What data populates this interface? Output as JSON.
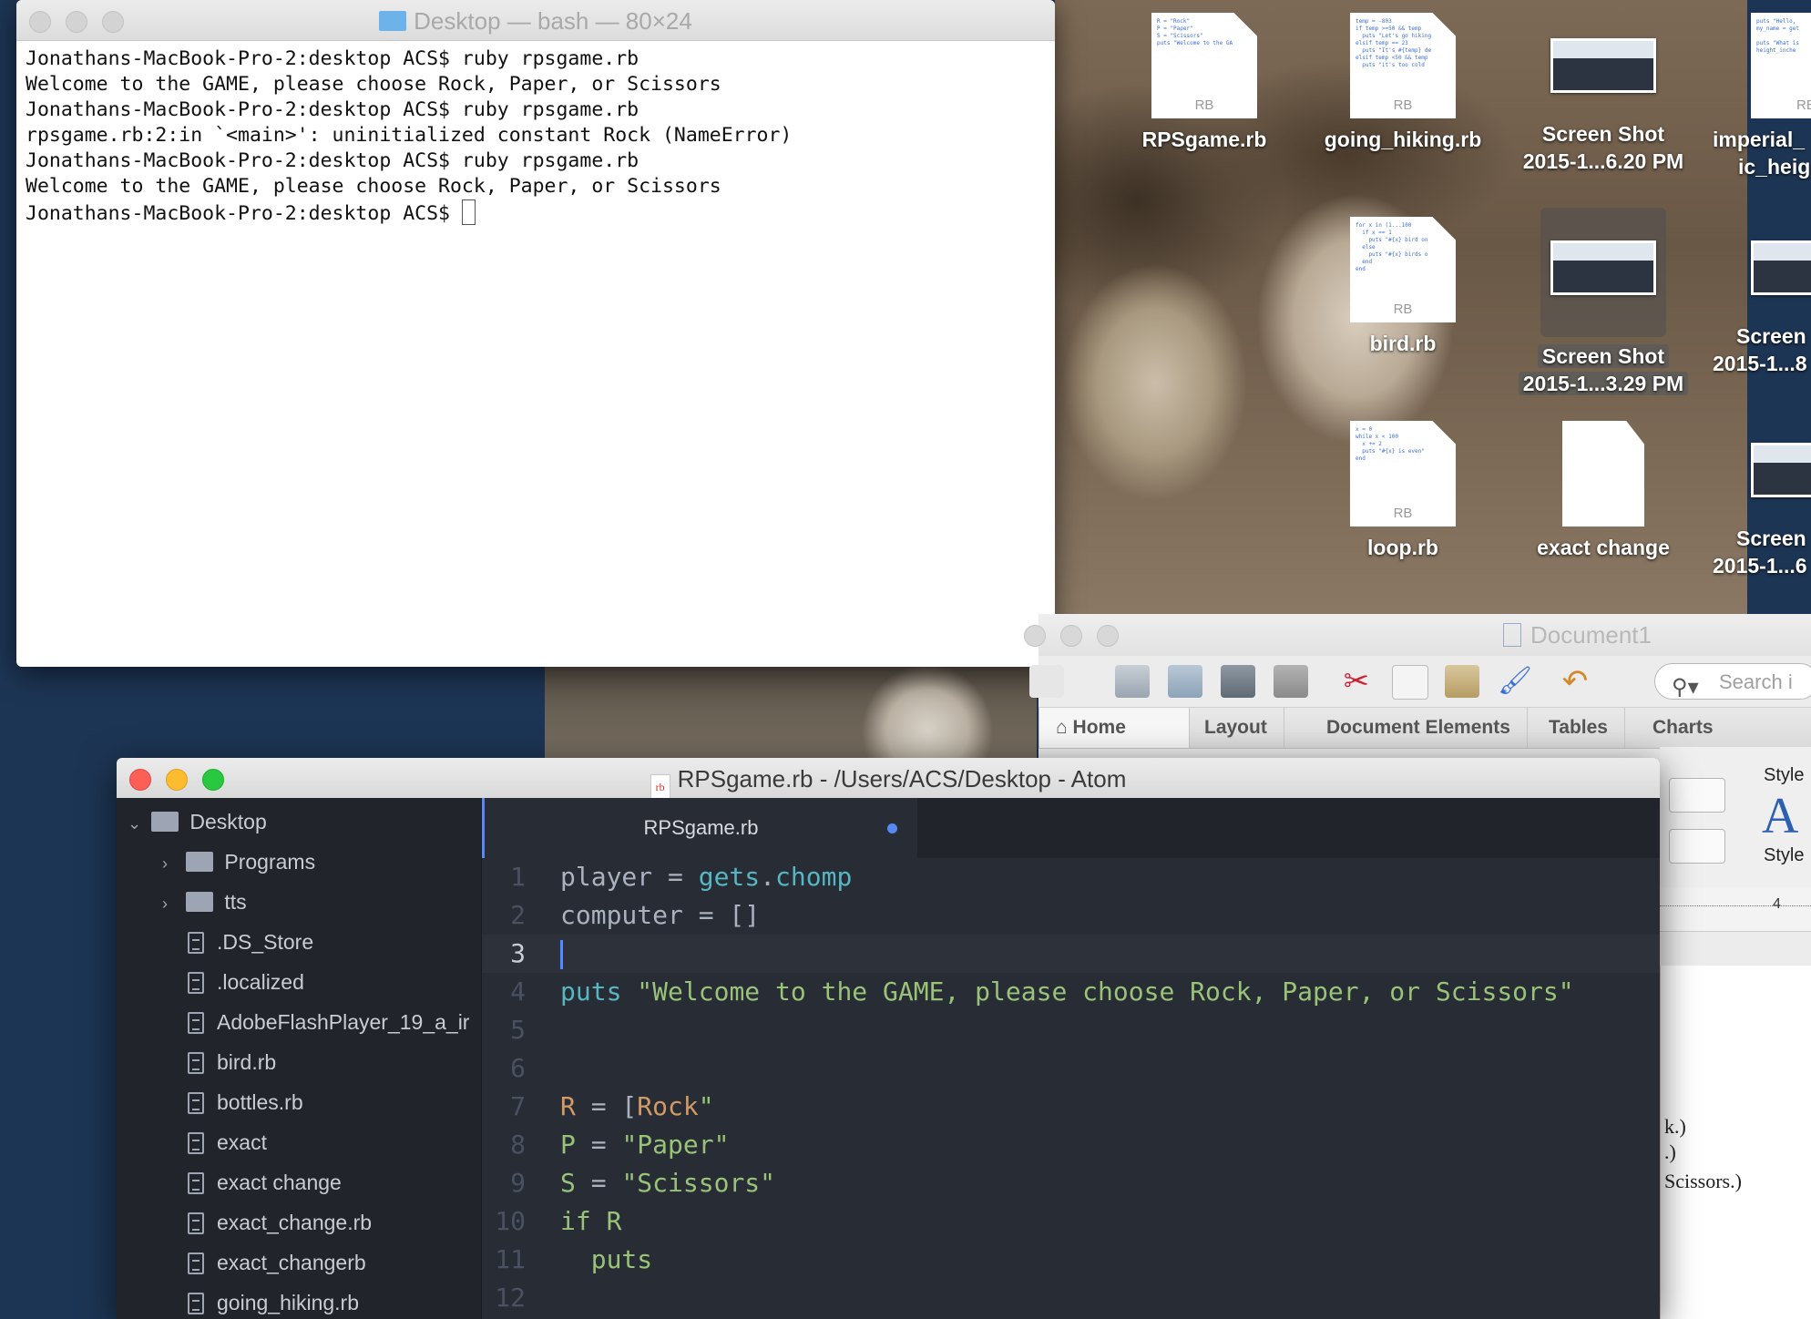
{
  "terminal": {
    "title": "Desktop — bash — 80×24",
    "lines": [
      "Jonathans-MacBook-Pro-2:desktop ACS$ ruby rpsgame.rb",
      "Welcome to the GAME, please choose Rock, Paper, or Scissors",
      "Jonathans-MacBook-Pro-2:desktop ACS$ ruby rpsgame.rb",
      "rpsgame.rb:2:in `<main>': uninitialized constant Rock (NameError)",
      "Jonathans-MacBook-Pro-2:desktop ACS$ ruby rpsgame.rb",
      "Welcome to the GAME, please choose Rock, Paper, or Scissors",
      "Jonathans-MacBook-Pro-2:desktop ACS$ "
    ]
  },
  "desktop": {
    "icons": [
      {
        "name": "RPSgame.rb",
        "badge": "RB"
      },
      {
        "name": "going_hiking.rb",
        "badge": "RB"
      },
      {
        "name_line1": "Screen Shot",
        "name_line2": "2015-1...6.20 PM"
      },
      {
        "name_line1": "imperial_",
        "name_line2": "ic_heig",
        "badge": "RB"
      },
      {
        "name": "bird.rb",
        "badge": "RB"
      },
      {
        "name_line1": "Screen Shot",
        "name_line2": "2015-1...3.29 PM"
      },
      {
        "name_line1": "Screen",
        "name_line2": "2015-1...8"
      },
      {
        "name": "loop.rb",
        "badge": "RB"
      },
      {
        "name": "exact change"
      },
      {
        "name_line1": "Screen",
        "name_line2": "2015-1...6"
      }
    ]
  },
  "word": {
    "title": "Document1",
    "search_placeholder": "Search i",
    "tabs": [
      "Home",
      "Layout",
      "Document Elements",
      "Tables",
      "Charts"
    ],
    "styles_label_top": "Style",
    "styles_label_bottom": "Style",
    "ruler_mark": "4",
    "page_lines": [
      "k.)",
      ".)",
      "Scissors.)"
    ]
  },
  "atom": {
    "title": "RPSgame.rb - /Users/ACS/Desktop - Atom",
    "tab_label": "RPSgame.rb",
    "tree": {
      "root": "Desktop",
      "folders": [
        "Programs",
        "tts"
      ],
      "files": [
        ".DS_Store",
        ".localized",
        "AdobeFlashPlayer_19_a_ir",
        "bird.rb",
        "bottles.rb",
        "exact",
        "exact change",
        "exact_change.rb",
        "exact_changerb",
        "going_hiking.rb"
      ]
    },
    "code": [
      {
        "n": "1",
        "text": "player = gets.chomp"
      },
      {
        "n": "2",
        "text": "computer = []"
      },
      {
        "n": "3",
        "text": ""
      },
      {
        "n": "4",
        "text": "puts \"Welcome to the GAME, please choose Rock, Paper, or Scissors\""
      },
      {
        "n": "5",
        "text": ""
      },
      {
        "n": "6",
        "text": ""
      },
      {
        "n": "7",
        "text": "R = [Rock\""
      },
      {
        "n": "8",
        "text": "P = \"Paper\""
      },
      {
        "n": "9",
        "text": "S = \"Scissors\""
      },
      {
        "n": "10",
        "text": "if R"
      },
      {
        "n": "11",
        "text": "  puts"
      },
      {
        "n": "12",
        "text": ""
      }
    ]
  },
  "colors": {
    "accent_blue": "#568af2",
    "string_green": "#98c379",
    "function_cyan": "#56b6c2",
    "constant_orange": "#d19a66"
  }
}
